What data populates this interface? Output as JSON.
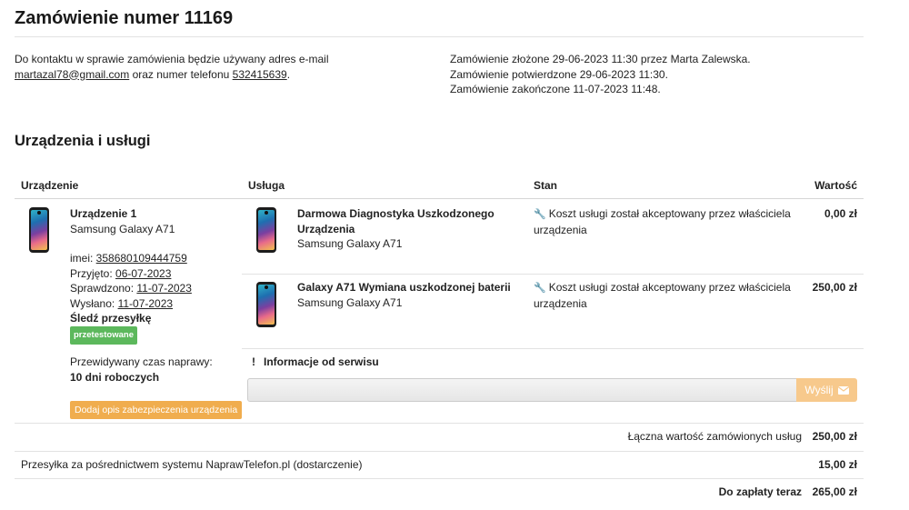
{
  "page": {
    "title": "Zamówienie numer 11169"
  },
  "contact": {
    "line1": "Do kontaktu w sprawie zamówienia będzie używany adres e-mail",
    "email": "martazal78@gmail.com",
    "mid": " oraz numer telefonu ",
    "phone": "532415639",
    "end": "."
  },
  "order_status": {
    "placed": "Zamówienie złożone 29-06-2023 11:30 przez Marta Zalewska.",
    "confirmed": "Zamówienie potwierdzone 29-06-2023 11:30.",
    "completed": "Zamówienie zakończone 11-07-2023 11:48."
  },
  "section": {
    "title": "Urządzenia i usługi"
  },
  "table": {
    "headers": {
      "device": "Urządzenie",
      "service": "Usługa",
      "state": "Stan",
      "value": "Wartość"
    }
  },
  "device": {
    "name": "Urządzenie 1",
    "model": "Samsung Galaxy A71",
    "imei_label": "imei: ",
    "imei": "358680109444759",
    "received_label": "Przyjęto: ",
    "received": "06-07-2023",
    "checked_label": "Sprawdzono: ",
    "checked": "11-07-2023",
    "sent_label": "Wysłano: ",
    "sent": "11-07-2023",
    "track": "Śledź przesyłkę",
    "badge": "przetestowane",
    "repair_time_label": "Przewidywany czas naprawy:",
    "repair_time": "10 dni roboczych",
    "add_security_button": "Dodaj opis zabezpieczenia urządzenia"
  },
  "services": [
    {
      "name_line1": "Darmowa Diagnostyka Uszkodzonego",
      "name_line2": "Urządzenia",
      "model": "Samsung Galaxy A71",
      "state_line1": "Koszt usługi został akceptowany przez właściciela",
      "state_line2": "urządzenia",
      "value": "0,00 zł"
    },
    {
      "name_line1": "Galaxy A71 Wymiana uszkodzonej baterii",
      "model": "Samsung Galaxy A71",
      "state_line1": "Koszt usługi został akceptowany przez właściciela",
      "state_line2": "urządzenia",
      "value": "250,00 zł"
    }
  ],
  "service_info": {
    "icon": "exclamation-icon",
    "title": "Informacje od serwisu",
    "input_value": "",
    "send_label": "Wyślij",
    "send_icon": "envelope-icon"
  },
  "totals": {
    "services_label": "Łączna wartość zamówionych usług",
    "services_value": "250,00 zł",
    "shipping_label": "Przesyłka za pośrednictwem systemu NaprawTelefon.pl (dostarczenie)",
    "shipping_value": "15,00 zł",
    "due_label": "Do zapłaty teraz",
    "due_value": "265,00 zł"
  },
  "colors": {
    "badge_green": "#5cb85c",
    "button_orange": "#f0ad4e",
    "send_button": "#f7c98c"
  }
}
